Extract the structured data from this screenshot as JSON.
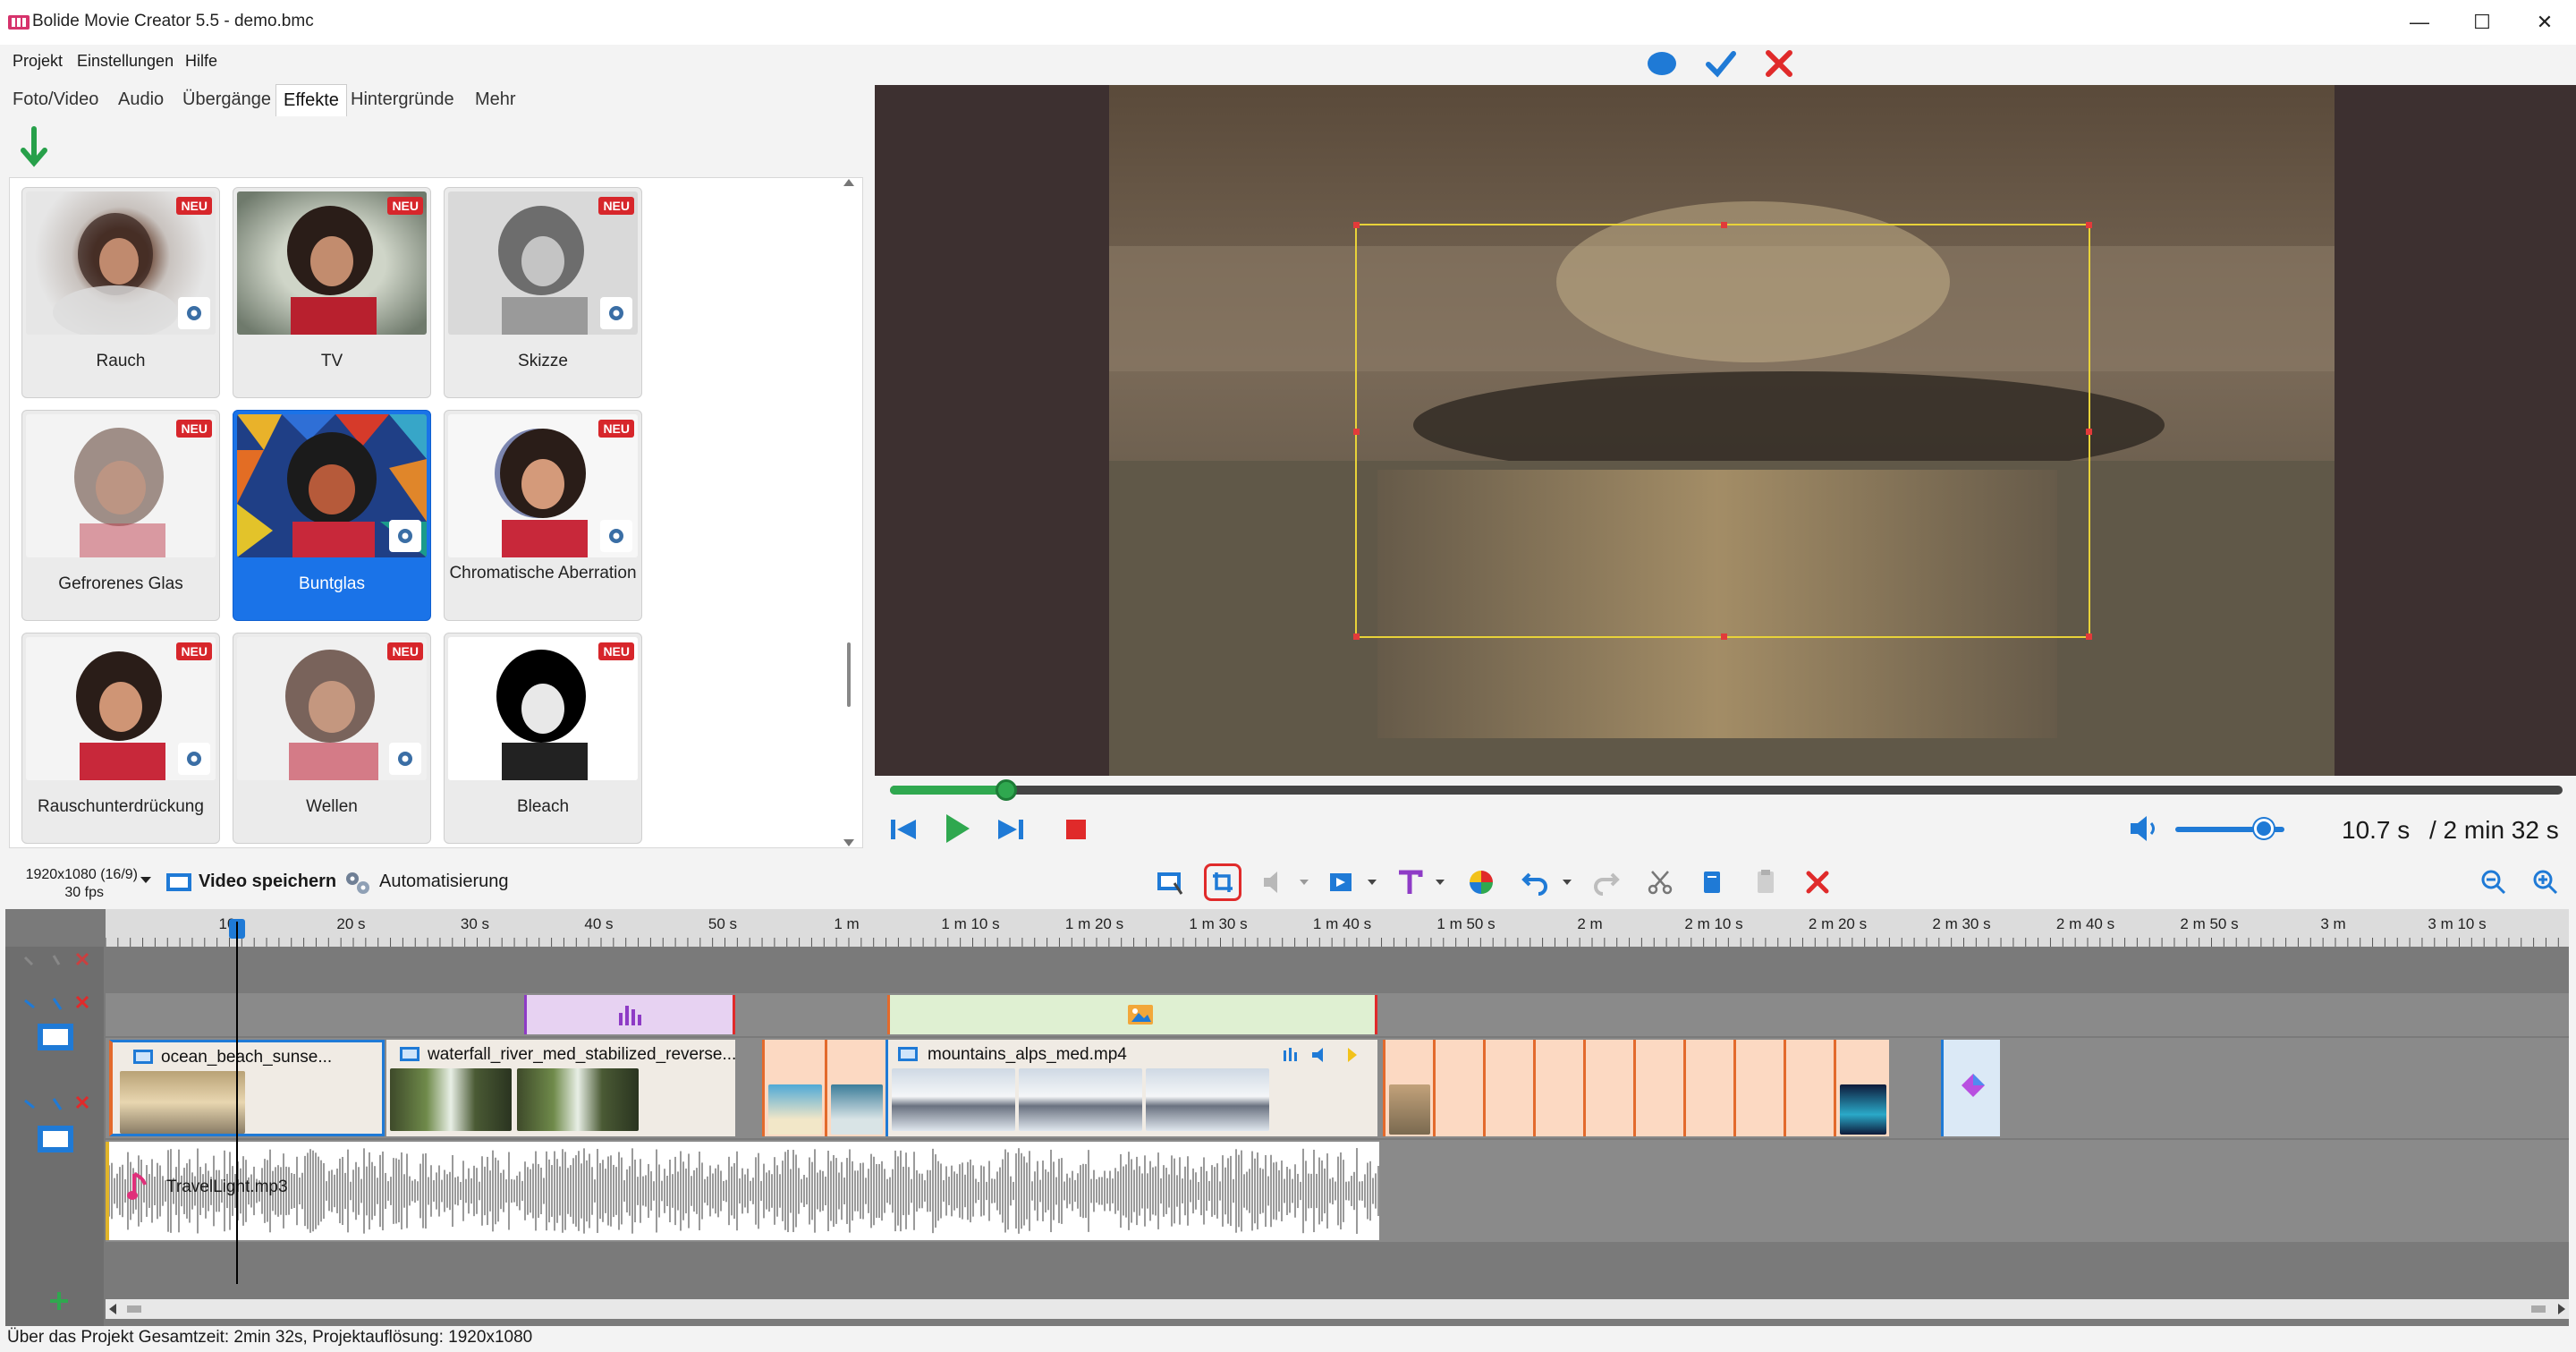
{
  "window": {
    "title": "Bolide Movie Creator 5.5 - demo.bmc",
    "minimize": "—",
    "maximize": "☐",
    "close": "✕"
  },
  "menu": {
    "items": [
      "Projekt",
      "Einstellungen",
      "Hilfe"
    ]
  },
  "tabs": [
    {
      "label": "Foto/Video"
    },
    {
      "label": "Audio"
    },
    {
      "label": "Übergänge"
    },
    {
      "label": "Effekte",
      "active": true
    },
    {
      "label": "Hintergründe"
    },
    {
      "label": "Mehr"
    }
  ],
  "effects": [
    {
      "label": "Rauch",
      "badge": "NEU",
      "gear": true
    },
    {
      "label": "TV",
      "badge": "NEU",
      "gear": false
    },
    {
      "label": "Skizze",
      "badge": "NEU",
      "gear": true
    },
    {
      "label": "Gefrorenes Glas",
      "badge": "NEU",
      "gear": false
    },
    {
      "label": "Buntglas",
      "badge": "",
      "gear": true,
      "selected": true
    },
    {
      "label": "Chromatische Aberration",
      "badge": "NEU",
      "gear": true
    },
    {
      "label": "Rauschunterdrückung",
      "badge": "NEU",
      "gear": true
    },
    {
      "label": "Wellen",
      "badge": "NEU",
      "gear": true
    },
    {
      "label": "Bleach",
      "badge": "NEU",
      "gear": false
    }
  ],
  "preview": {
    "progress": 0.07
  },
  "playback": {
    "current_time": "10.7 s",
    "total_time": "/ 2 min 32 s",
    "volume": 0.75
  },
  "toolbar": {
    "resolution": "1920x1080 (16/9)",
    "fps": "30 fps",
    "save_video": "Video speichern",
    "automation": "Automatisierung"
  },
  "ruler": {
    "labels": [
      "10",
      "20 s",
      "30 s",
      "40 s",
      "50 s",
      "1 m",
      "1 m 10 s",
      "1 m 20 s",
      "1 m 30 s",
      "1 m 40 s",
      "1 m 50 s",
      "2 m",
      "2 m 10 s",
      "2 m 20 s",
      "2 m 30 s",
      "2 m 40 s",
      "2 m 50 s",
      "3 m",
      "3 m 10 s"
    ]
  },
  "clips": {
    "video1": "ocean_beach_sunse...",
    "video2": "waterfall_river_med_stabilized_reverse...",
    "video3": "mountains_alps_med.mp4",
    "audio": "TravelLight.mp3"
  },
  "status": {
    "text": "Über das Projekt Gesamtzeit: 2min 32s,   Projektauflösung:   1920x1080"
  },
  "colors": {
    "accent": "#1a73e8",
    "badge": "#d7262b",
    "play": "#2fa84f"
  }
}
